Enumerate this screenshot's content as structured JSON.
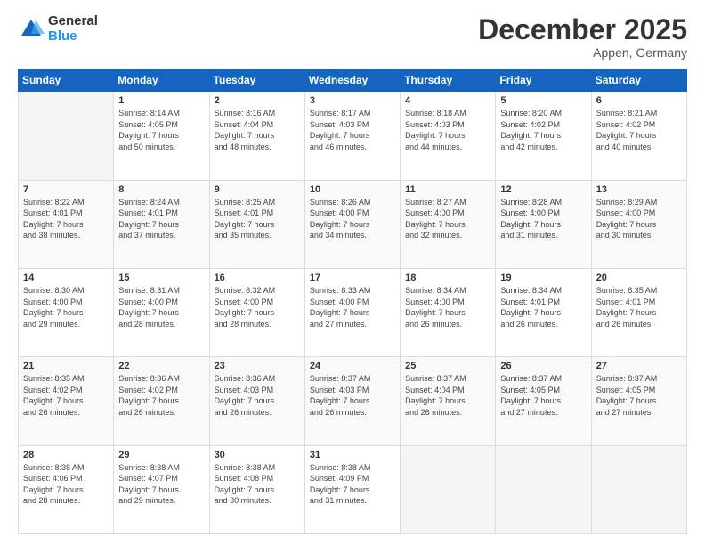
{
  "header": {
    "logo_general": "General",
    "logo_blue": "Blue",
    "month_title": "December 2025",
    "location": "Appen, Germany"
  },
  "days_of_week": [
    "Sunday",
    "Monday",
    "Tuesday",
    "Wednesday",
    "Thursday",
    "Friday",
    "Saturday"
  ],
  "weeks": [
    [
      {
        "day": "",
        "info": ""
      },
      {
        "day": "1",
        "info": "Sunrise: 8:14 AM\nSunset: 4:05 PM\nDaylight: 7 hours\nand 50 minutes."
      },
      {
        "day": "2",
        "info": "Sunrise: 8:16 AM\nSunset: 4:04 PM\nDaylight: 7 hours\nand 48 minutes."
      },
      {
        "day": "3",
        "info": "Sunrise: 8:17 AM\nSunset: 4:03 PM\nDaylight: 7 hours\nand 46 minutes."
      },
      {
        "day": "4",
        "info": "Sunrise: 8:18 AM\nSunset: 4:03 PM\nDaylight: 7 hours\nand 44 minutes."
      },
      {
        "day": "5",
        "info": "Sunrise: 8:20 AM\nSunset: 4:02 PM\nDaylight: 7 hours\nand 42 minutes."
      },
      {
        "day": "6",
        "info": "Sunrise: 8:21 AM\nSunset: 4:02 PM\nDaylight: 7 hours\nand 40 minutes."
      }
    ],
    [
      {
        "day": "7",
        "info": "Sunrise: 8:22 AM\nSunset: 4:01 PM\nDaylight: 7 hours\nand 38 minutes."
      },
      {
        "day": "8",
        "info": "Sunrise: 8:24 AM\nSunset: 4:01 PM\nDaylight: 7 hours\nand 37 minutes."
      },
      {
        "day": "9",
        "info": "Sunrise: 8:25 AM\nSunset: 4:01 PM\nDaylight: 7 hours\nand 35 minutes."
      },
      {
        "day": "10",
        "info": "Sunrise: 8:26 AM\nSunset: 4:00 PM\nDaylight: 7 hours\nand 34 minutes."
      },
      {
        "day": "11",
        "info": "Sunrise: 8:27 AM\nSunset: 4:00 PM\nDaylight: 7 hours\nand 32 minutes."
      },
      {
        "day": "12",
        "info": "Sunrise: 8:28 AM\nSunset: 4:00 PM\nDaylight: 7 hours\nand 31 minutes."
      },
      {
        "day": "13",
        "info": "Sunrise: 8:29 AM\nSunset: 4:00 PM\nDaylight: 7 hours\nand 30 minutes."
      }
    ],
    [
      {
        "day": "14",
        "info": "Sunrise: 8:30 AM\nSunset: 4:00 PM\nDaylight: 7 hours\nand 29 minutes."
      },
      {
        "day": "15",
        "info": "Sunrise: 8:31 AM\nSunset: 4:00 PM\nDaylight: 7 hours\nand 28 minutes."
      },
      {
        "day": "16",
        "info": "Sunrise: 8:32 AM\nSunset: 4:00 PM\nDaylight: 7 hours\nand 28 minutes."
      },
      {
        "day": "17",
        "info": "Sunrise: 8:33 AM\nSunset: 4:00 PM\nDaylight: 7 hours\nand 27 minutes."
      },
      {
        "day": "18",
        "info": "Sunrise: 8:34 AM\nSunset: 4:00 PM\nDaylight: 7 hours\nand 26 minutes."
      },
      {
        "day": "19",
        "info": "Sunrise: 8:34 AM\nSunset: 4:01 PM\nDaylight: 7 hours\nand 26 minutes."
      },
      {
        "day": "20",
        "info": "Sunrise: 8:35 AM\nSunset: 4:01 PM\nDaylight: 7 hours\nand 26 minutes."
      }
    ],
    [
      {
        "day": "21",
        "info": "Sunrise: 8:35 AM\nSunset: 4:02 PM\nDaylight: 7 hours\nand 26 minutes."
      },
      {
        "day": "22",
        "info": "Sunrise: 8:36 AM\nSunset: 4:02 PM\nDaylight: 7 hours\nand 26 minutes."
      },
      {
        "day": "23",
        "info": "Sunrise: 8:36 AM\nSunset: 4:03 PM\nDaylight: 7 hours\nand 26 minutes."
      },
      {
        "day": "24",
        "info": "Sunrise: 8:37 AM\nSunset: 4:03 PM\nDaylight: 7 hours\nand 26 minutes."
      },
      {
        "day": "25",
        "info": "Sunrise: 8:37 AM\nSunset: 4:04 PM\nDaylight: 7 hours\nand 26 minutes."
      },
      {
        "day": "26",
        "info": "Sunrise: 8:37 AM\nSunset: 4:05 PM\nDaylight: 7 hours\nand 27 minutes."
      },
      {
        "day": "27",
        "info": "Sunrise: 8:37 AM\nSunset: 4:05 PM\nDaylight: 7 hours\nand 27 minutes."
      }
    ],
    [
      {
        "day": "28",
        "info": "Sunrise: 8:38 AM\nSunset: 4:06 PM\nDaylight: 7 hours\nand 28 minutes."
      },
      {
        "day": "29",
        "info": "Sunrise: 8:38 AM\nSunset: 4:07 PM\nDaylight: 7 hours\nand 29 minutes."
      },
      {
        "day": "30",
        "info": "Sunrise: 8:38 AM\nSunset: 4:08 PM\nDaylight: 7 hours\nand 30 minutes."
      },
      {
        "day": "31",
        "info": "Sunrise: 8:38 AM\nSunset: 4:09 PM\nDaylight: 7 hours\nand 31 minutes."
      },
      {
        "day": "",
        "info": ""
      },
      {
        "day": "",
        "info": ""
      },
      {
        "day": "",
        "info": ""
      }
    ]
  ]
}
